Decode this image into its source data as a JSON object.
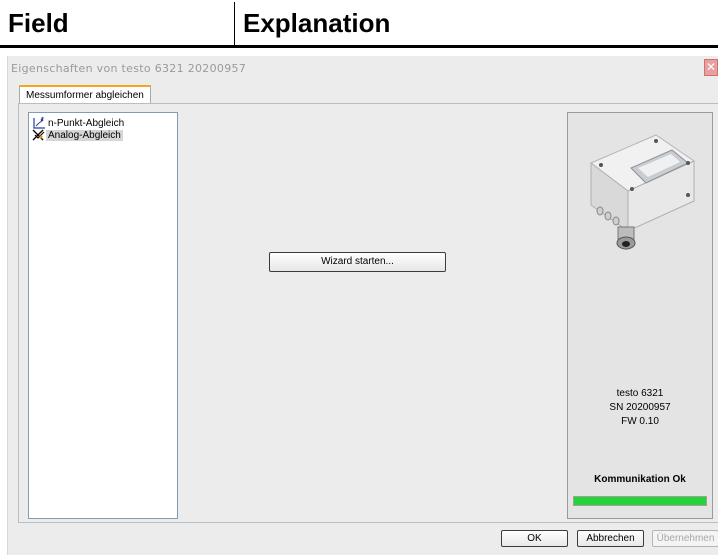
{
  "doc": {
    "col_field": "Field",
    "col_explanation": "Explanation"
  },
  "dialog": {
    "title": "Eigenschaften von testo 6321  20200957",
    "close_glyph": "✕",
    "tab_label": "Messumformer abgleichen",
    "tree": [
      {
        "label": "n-Punkt-Abgleich",
        "icon": "npoint-calibration-icon",
        "selected": false
      },
      {
        "label": "Analog-Abgleich",
        "icon": "analog-calibration-icon",
        "selected": true
      }
    ],
    "wizard_button": "Wizard starten...",
    "device": {
      "model": "testo 6321",
      "serial": "SN 20200957",
      "firmware": "FW  0.10",
      "comm_status": "Kommunikation Ok",
      "comm_level": 1.0,
      "status_color": "#25d33a"
    },
    "buttons": {
      "ok": "OK",
      "cancel": "Abbrechen",
      "apply": "Übernehmen"
    }
  },
  "colors": {
    "tab_accent": "#f5a623",
    "tree_border": "#7f9db9",
    "dialog_bg": "#ececec"
  }
}
